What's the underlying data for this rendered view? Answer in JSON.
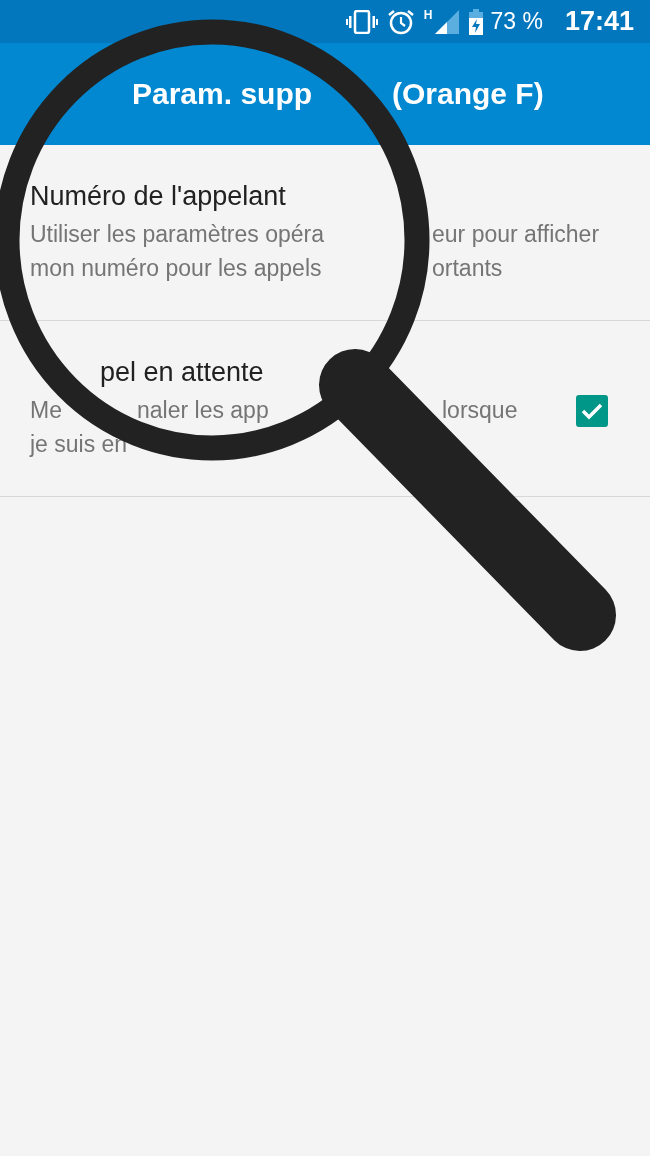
{
  "status_bar": {
    "network": "H",
    "battery": "73 %",
    "time": "17:41"
  },
  "app_bar": {
    "title_parts": [
      "Param. supp",
      "(Orange F)"
    ]
  },
  "settings": [
    {
      "kind": "plain",
      "title_parts": [
        "Numéro de l'appelant"
      ],
      "summary_lines": [
        [
          "Utiliser les paramètres opéra",
          "eur pour afficher"
        ],
        [
          "mon numéro pour les appels",
          "ortants"
        ]
      ]
    },
    {
      "kind": "checkbox",
      "checked": true,
      "title_parts": [
        "pel en attente"
      ],
      "summary_lines": [
        [
          "Me",
          "naler les app",
          "lorsque"
        ],
        [
          "je suis en"
        ]
      ]
    }
  ]
}
